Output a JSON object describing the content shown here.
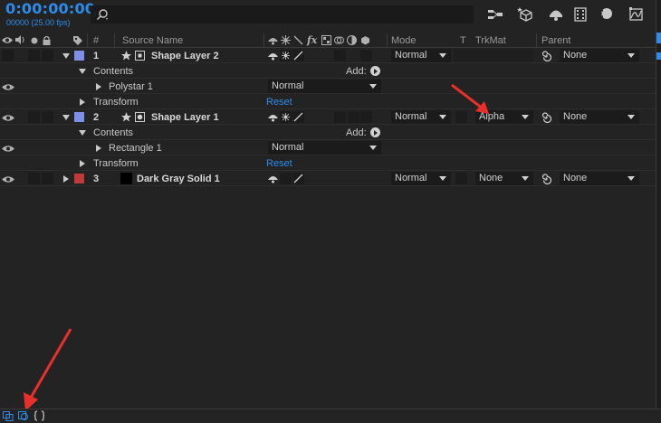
{
  "timecode": "0:00:00:00",
  "fps_label": "00000 (25.00 fps)",
  "search": {
    "placeholder": ""
  },
  "columns": {
    "num": "#",
    "source_name": "Source Name",
    "mode": "Mode",
    "t": "T",
    "trkmat": "TrkMat",
    "parent": "Parent"
  },
  "switch_glyphs": {
    "fx": "fx"
  },
  "layers": [
    {
      "num": "1",
      "name": "Shape Layer 2",
      "label_color": "#7f8fe8",
      "mode": "Normal",
      "trkmat": "",
      "parent": "None"
    },
    {
      "num": "2",
      "name": "Shape Layer 1",
      "label_color": "#7f8fe8",
      "mode": "Normal",
      "trkmat": "Alpha",
      "parent": "None"
    },
    {
      "num": "3",
      "name": "Dark Gray Solid 1",
      "label_color": "#c03a3a",
      "mode": "Normal",
      "trkmat": "None",
      "parent": "None"
    }
  ],
  "sub": {
    "contents": "Contents",
    "add": "Add:",
    "polystar": "Polystar 1",
    "rectangle": "Rectangle 1",
    "transform": "Transform",
    "reset": "Reset",
    "blend_normal": "Normal"
  },
  "colors": {
    "accent": "#2d8ceb",
    "arrow": "#e8302a"
  }
}
